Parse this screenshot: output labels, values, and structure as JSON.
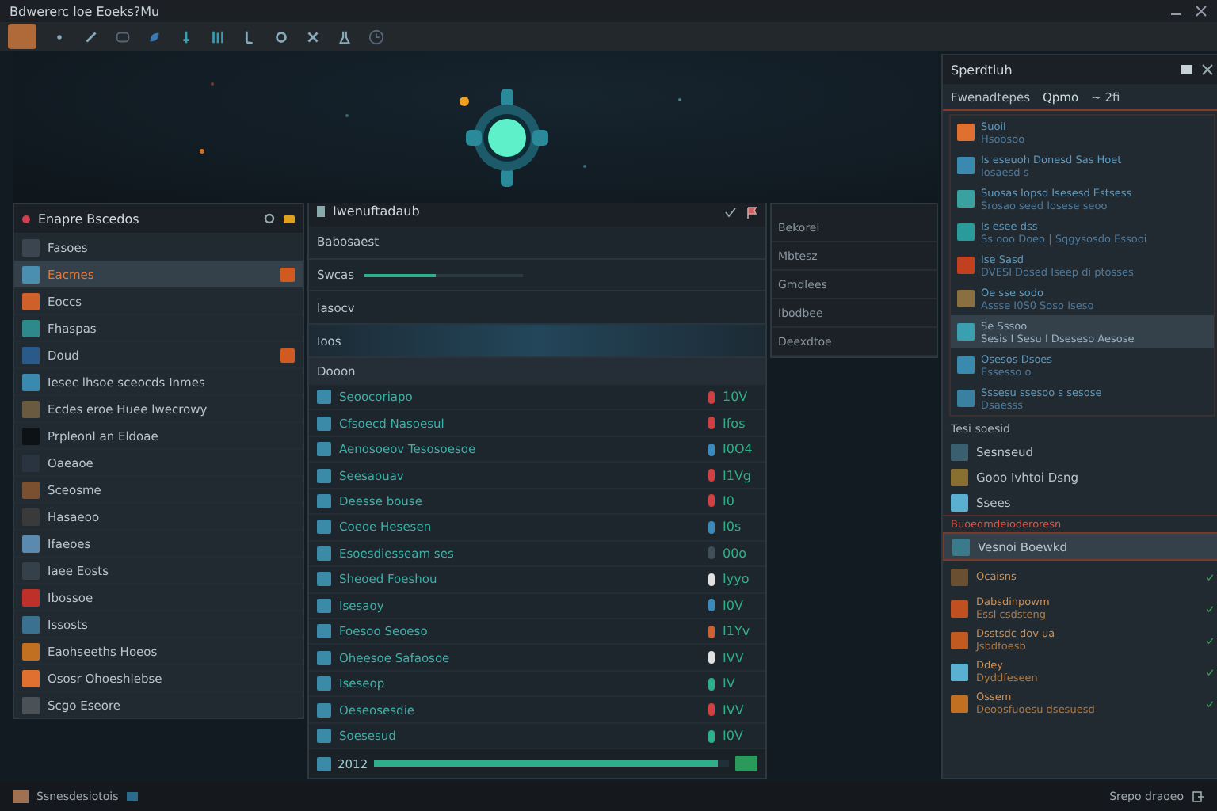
{
  "window": {
    "title": "Bdwererc loe Eoeks?Mu"
  },
  "left_panel": {
    "title": "Enapre Bscedos",
    "items": [
      {
        "label": "Fasoes",
        "color": "#3a4550",
        "selected": false,
        "flag": false
      },
      {
        "label": "Eacmes",
        "color": "#4a8fb0",
        "selected": true,
        "flag": true
      },
      {
        "label": "Eoccs",
        "color": "#d0602a",
        "selected": false,
        "flag": false
      },
      {
        "label": "Fhaspas",
        "color": "#2e8a8a",
        "selected": false,
        "flag": false
      },
      {
        "label": "Doud",
        "color": "#2a5a8a",
        "selected": false,
        "flag": true
      },
      {
        "label": "Iesec lhsoe sceocds Inmes",
        "color": "#3a8ab0",
        "selected": false,
        "flag": false
      },
      {
        "label": "Ecdes eroe Huee lwecrowy",
        "color": "#6a5a40",
        "selected": false,
        "flag": false
      },
      {
        "label": "Prpleonl an Eldoae",
        "color": "#0c1216",
        "selected": false,
        "flag": false
      },
      {
        "label": "Oaeaoe",
        "color": "#2a3440",
        "selected": false,
        "flag": false
      },
      {
        "label": "Sceosme",
        "color": "#7a5030",
        "selected": false,
        "flag": false
      },
      {
        "label": "Hasaeoo",
        "color": "#3a3a3a",
        "selected": false,
        "flag": false
      },
      {
        "label": "Ifaeoes",
        "color": "#5a8ab0",
        "selected": false,
        "flag": false
      },
      {
        "label": "Iaee Eosts",
        "color": "#34404a",
        "selected": false,
        "flag": false
      },
      {
        "label": "Ibossoe",
        "color": "#c0302a",
        "selected": false,
        "flag": false
      },
      {
        "label": "Issosts",
        "color": "#3a7090",
        "selected": false,
        "flag": false
      },
      {
        "label": "Eaohseeths Hoeos",
        "color": "#c07020",
        "selected": false,
        "flag": false
      },
      {
        "label": "Ososr Ohoeshlebse",
        "color": "#e07030",
        "selected": false,
        "flag": false
      },
      {
        "label": "Scgo Eseore",
        "color": "#4a5258",
        "selected": false,
        "flag": false
      }
    ]
  },
  "center_panel": {
    "title": "Iwenuftadaub",
    "top_rows": [
      {
        "label": "Babosaest"
      },
      {
        "label": "Swcas",
        "level": 0.45
      },
      {
        "label": "Iasocv"
      },
      {
        "label": "Ioos"
      }
    ],
    "header": "Dooon",
    "rows": [
      {
        "name": "Seoocoriapo",
        "color": "#d04040",
        "value": "10V"
      },
      {
        "name": "Cfsoecd Nasoesul",
        "color": "#d04040",
        "value": "Ifos"
      },
      {
        "name": "Aenosoeov Tesosoesoe",
        "color": "#3a8ac0",
        "value": "I0O4"
      },
      {
        "name": "Seesaouav",
        "color": "#d04040",
        "value": "I1Vg"
      },
      {
        "name": "Deesse bouse",
        "color": "#d04040",
        "value": "I0"
      },
      {
        "name": "Coeoe Hesesen",
        "color": "#3a8ac0",
        "value": "I0s"
      },
      {
        "name": "Esoesdiesseam ses",
        "color": "#40505a",
        "value": "00o"
      },
      {
        "name": "Sheoed Foeshou",
        "color": "#e0e0e0",
        "value": "Iyyo"
      },
      {
        "name": "Isesaoy",
        "color": "#3a8ac0",
        "value": "I0V"
      },
      {
        "name": "Foesoo Seoeso",
        "color": "#d06030",
        "value": "I1Yv"
      },
      {
        "name": "Oheesoe Safaosoe",
        "color": "#e0e0e0",
        "value": "IVV"
      },
      {
        "name": "Iseseop",
        "color": "#2ab08a",
        "value": "IV"
      },
      {
        "name": "Oeseosesdie",
        "color": "#d04040",
        "value": "IVV"
      },
      {
        "name": "Soesesud",
        "color": "#2ab08a",
        "value": "I0V"
      }
    ],
    "footer": {
      "label": "2012",
      "level": 0.97
    }
  },
  "back_panel": {
    "items": [
      "Bekorel",
      "Mbtesz",
      "Gmdlees",
      "Ibodbee",
      "Deexdtoe"
    ]
  },
  "right_panel": {
    "title": "Sperdtiuh",
    "filter": {
      "label": "Fwenadtepes",
      "value": "Qpmo",
      "extra": "~ 2fi"
    },
    "messages": [
      {
        "title": "Suoil",
        "subtitle": "Hsoosoo",
        "color": "#e07030",
        "selected": false
      },
      {
        "title": "Is eseuoh Donesd Sas Hoet",
        "subtitle": "Iosaesd s",
        "color": "#3a8ab0",
        "selected": false
      },
      {
        "title": "Suosas Iopsd Isesesd Estsess",
        "subtitle": "Srosao seed Iosese seoo",
        "color": "#3aa0a0",
        "selected": false
      },
      {
        "title": "Is esee dss",
        "subtitle": "Ss ooo Doeo | Sqgysosdo Essooi",
        "color": "#2a9a9a",
        "selected": false
      },
      {
        "title": "Ise Sasd",
        "subtitle": "DVESI Dosed Iseep di ptosses",
        "color": "#c04020",
        "selected": false
      },
      {
        "title": "Oe sse sodo",
        "subtitle": "Assse I0S0 Soso Iseso",
        "color": "#8a7040",
        "selected": false
      },
      {
        "title": "Se Sssoo",
        "subtitle": "Sesis I Sesu I Dseseso Aesose",
        "color": "#3aa0b0",
        "selected": true
      },
      {
        "title": "Osesos Dsoes",
        "subtitle": "Essesso o",
        "color": "#3a8ab0",
        "selected": false
      },
      {
        "title": "Sssesu ssesoo s sesose",
        "subtitle": "Dsaesss",
        "color": "#3a80a0",
        "selected": false
      }
    ],
    "section": {
      "title": "Tesi soesid",
      "items": [
        {
          "label": "Sesnseud",
          "color": "#3a6070"
        },
        {
          "label": "Gooo Ivhtoi Dsng",
          "color": "#8a7030"
        },
        {
          "label": "Ssees",
          "color": "#5ab0d0"
        }
      ]
    },
    "alert": "Buoedmdeioderoresn",
    "alert_item": {
      "label": "Vesnoi Boewkd",
      "selected": true
    },
    "tasks": [
      {
        "title": "Ocaisns",
        "color": "#6a5030"
      },
      {
        "title": "Dabsdinpowm",
        "subtitle": "Essl csdsteng",
        "color": "#c05020"
      },
      {
        "title": "Dsstsdc dov ua",
        "subtitle": "Jsbdfoesb",
        "color": "#c05a20"
      },
      {
        "title": "Ddey",
        "subtitle": "Dyddfeseen",
        "color": "#5ab0d0"
      },
      {
        "title": "Ossem",
        "subtitle": "Deoosfuoesu dsesuesd",
        "color": "#c07020"
      }
    ]
  },
  "status_bar": {
    "left": "Ssnesdesiotois",
    "right": "Srepo draoeo"
  }
}
